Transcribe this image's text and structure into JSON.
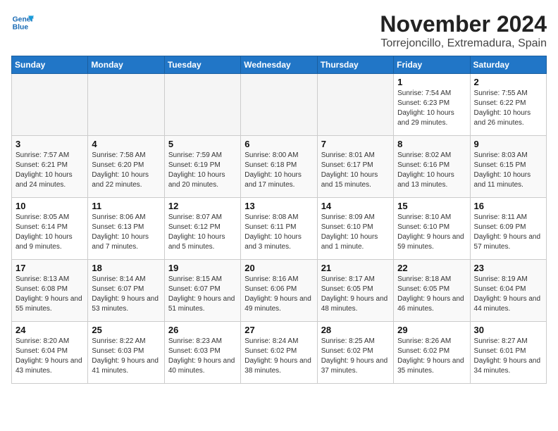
{
  "logo": {
    "line1": "General",
    "line2": "Blue"
  },
  "title": "November 2024",
  "location": "Torrejoncillo, Extremadura, Spain",
  "headers": [
    "Sunday",
    "Monday",
    "Tuesday",
    "Wednesday",
    "Thursday",
    "Friday",
    "Saturday"
  ],
  "weeks": [
    [
      {
        "day": "",
        "info": ""
      },
      {
        "day": "",
        "info": ""
      },
      {
        "day": "",
        "info": ""
      },
      {
        "day": "",
        "info": ""
      },
      {
        "day": "",
        "info": ""
      },
      {
        "day": "1",
        "info": "Sunrise: 7:54 AM\nSunset: 6:23 PM\nDaylight: 10 hours and 29 minutes."
      },
      {
        "day": "2",
        "info": "Sunrise: 7:55 AM\nSunset: 6:22 PM\nDaylight: 10 hours and 26 minutes."
      }
    ],
    [
      {
        "day": "3",
        "info": "Sunrise: 7:57 AM\nSunset: 6:21 PM\nDaylight: 10 hours and 24 minutes."
      },
      {
        "day": "4",
        "info": "Sunrise: 7:58 AM\nSunset: 6:20 PM\nDaylight: 10 hours and 22 minutes."
      },
      {
        "day": "5",
        "info": "Sunrise: 7:59 AM\nSunset: 6:19 PM\nDaylight: 10 hours and 20 minutes."
      },
      {
        "day": "6",
        "info": "Sunrise: 8:00 AM\nSunset: 6:18 PM\nDaylight: 10 hours and 17 minutes."
      },
      {
        "day": "7",
        "info": "Sunrise: 8:01 AM\nSunset: 6:17 PM\nDaylight: 10 hours and 15 minutes."
      },
      {
        "day": "8",
        "info": "Sunrise: 8:02 AM\nSunset: 6:16 PM\nDaylight: 10 hours and 13 minutes."
      },
      {
        "day": "9",
        "info": "Sunrise: 8:03 AM\nSunset: 6:15 PM\nDaylight: 10 hours and 11 minutes."
      }
    ],
    [
      {
        "day": "10",
        "info": "Sunrise: 8:05 AM\nSunset: 6:14 PM\nDaylight: 10 hours and 9 minutes."
      },
      {
        "day": "11",
        "info": "Sunrise: 8:06 AM\nSunset: 6:13 PM\nDaylight: 10 hours and 7 minutes."
      },
      {
        "day": "12",
        "info": "Sunrise: 8:07 AM\nSunset: 6:12 PM\nDaylight: 10 hours and 5 minutes."
      },
      {
        "day": "13",
        "info": "Sunrise: 8:08 AM\nSunset: 6:11 PM\nDaylight: 10 hours and 3 minutes."
      },
      {
        "day": "14",
        "info": "Sunrise: 8:09 AM\nSunset: 6:10 PM\nDaylight: 10 hours and 1 minute."
      },
      {
        "day": "15",
        "info": "Sunrise: 8:10 AM\nSunset: 6:10 PM\nDaylight: 9 hours and 59 minutes."
      },
      {
        "day": "16",
        "info": "Sunrise: 8:11 AM\nSunset: 6:09 PM\nDaylight: 9 hours and 57 minutes."
      }
    ],
    [
      {
        "day": "17",
        "info": "Sunrise: 8:13 AM\nSunset: 6:08 PM\nDaylight: 9 hours and 55 minutes."
      },
      {
        "day": "18",
        "info": "Sunrise: 8:14 AM\nSunset: 6:07 PM\nDaylight: 9 hours and 53 minutes."
      },
      {
        "day": "19",
        "info": "Sunrise: 8:15 AM\nSunset: 6:07 PM\nDaylight: 9 hours and 51 minutes."
      },
      {
        "day": "20",
        "info": "Sunrise: 8:16 AM\nSunset: 6:06 PM\nDaylight: 9 hours and 49 minutes."
      },
      {
        "day": "21",
        "info": "Sunrise: 8:17 AM\nSunset: 6:05 PM\nDaylight: 9 hours and 48 minutes."
      },
      {
        "day": "22",
        "info": "Sunrise: 8:18 AM\nSunset: 6:05 PM\nDaylight: 9 hours and 46 minutes."
      },
      {
        "day": "23",
        "info": "Sunrise: 8:19 AM\nSunset: 6:04 PM\nDaylight: 9 hours and 44 minutes."
      }
    ],
    [
      {
        "day": "24",
        "info": "Sunrise: 8:20 AM\nSunset: 6:04 PM\nDaylight: 9 hours and 43 minutes."
      },
      {
        "day": "25",
        "info": "Sunrise: 8:22 AM\nSunset: 6:03 PM\nDaylight: 9 hours and 41 minutes."
      },
      {
        "day": "26",
        "info": "Sunrise: 8:23 AM\nSunset: 6:03 PM\nDaylight: 9 hours and 40 minutes."
      },
      {
        "day": "27",
        "info": "Sunrise: 8:24 AM\nSunset: 6:02 PM\nDaylight: 9 hours and 38 minutes."
      },
      {
        "day": "28",
        "info": "Sunrise: 8:25 AM\nSunset: 6:02 PM\nDaylight: 9 hours and 37 minutes."
      },
      {
        "day": "29",
        "info": "Sunrise: 8:26 AM\nSunset: 6:02 PM\nDaylight: 9 hours and 35 minutes."
      },
      {
        "day": "30",
        "info": "Sunrise: 8:27 AM\nSunset: 6:01 PM\nDaylight: 9 hours and 34 minutes."
      }
    ]
  ]
}
